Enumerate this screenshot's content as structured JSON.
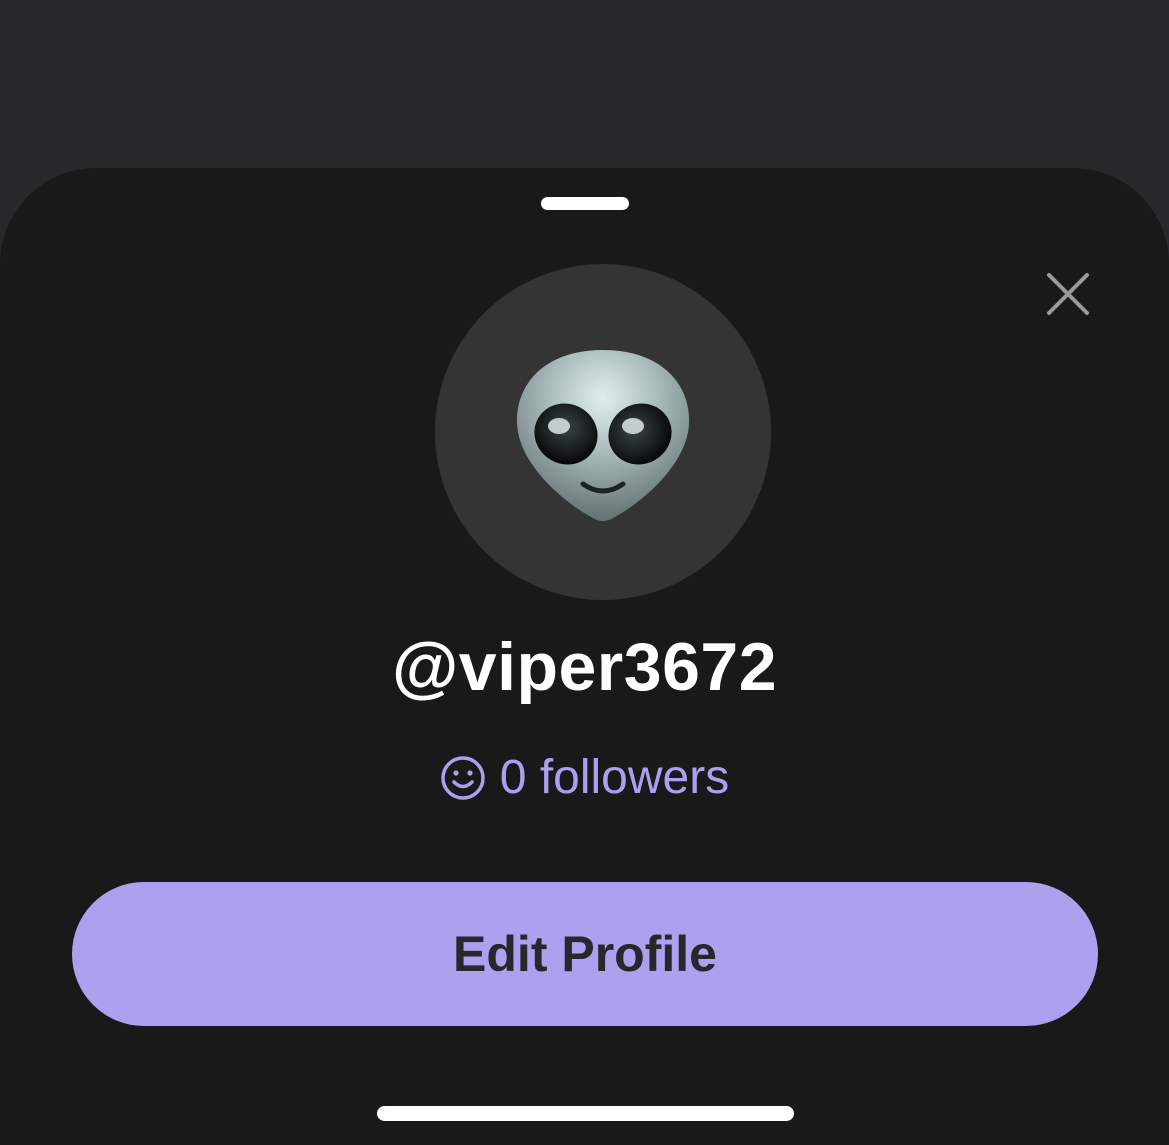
{
  "profile_sheet": {
    "username": "@viper3672",
    "followers_label": "0 followers",
    "edit_button_label": "Edit Profile",
    "avatar_emoji": "alien-face",
    "close_icon": "close-icon"
  },
  "colors": {
    "backdrop": "#28282b",
    "sheet_background": "#19191a",
    "avatar_circle": "#343434",
    "accent": "#ada0ef",
    "button_text": "#28272c",
    "text_primary": "#ffffff"
  }
}
